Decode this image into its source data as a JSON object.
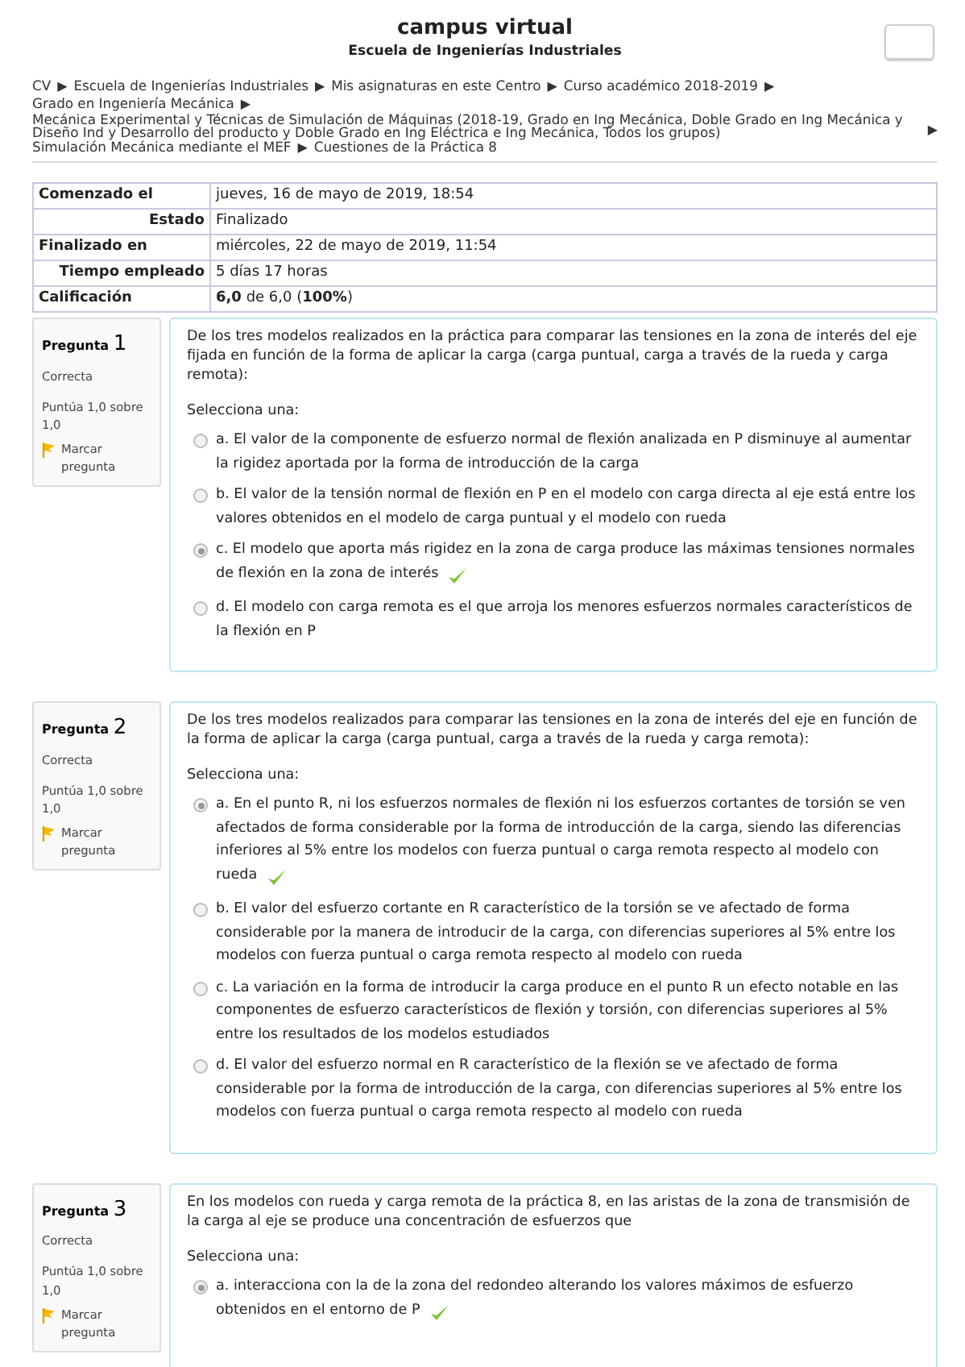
{
  "header": {
    "title": "campus virtual",
    "subtitle": "Escuela de Ingenierías Industriales"
  },
  "breadcrumb": {
    "separator": "▶",
    "lines": [
      [
        "CV",
        "Escuela de Ingenierías Industriales",
        "Mis asignaturas en este Centro",
        "Curso académico 2018-2019"
      ],
      [
        "Grado en Ingeniería Mecánica"
      ],
      [
        "Mecánica Experimental y Técnicas de Simulación de Máquinas (2018-19, Grado en Ing Mecánica, Doble Grado en Ing Mecánica y Diseño Ind y Desarrollo del producto y Doble Grado en Ing Eléctrica e Ing Mecánica, Todos los grupos)"
      ],
      [
        "Simulación Mecánica mediante el MEF",
        "Cuestiones de la Práctica 8"
      ]
    ]
  },
  "summary": [
    {
      "label": "Comenzado el",
      "value": "jueves, 16 de mayo de 2019, 18:54",
      "kind": "plain"
    },
    {
      "label": "Estado",
      "value": "Finalizado",
      "kind": "inset"
    },
    {
      "label": "Finalizado en",
      "value": "miércoles, 22 de mayo de 2019, 11:54",
      "kind": "plain"
    },
    {
      "label": "Tiempo empleado",
      "value": "5 días 17 horas",
      "kind": "inset"
    },
    {
      "label": "Calificación",
      "value": "**6,0** de 6,0 (**100%**)",
      "kind": "plain"
    }
  ],
  "questions": [
    {
      "label": "Pregunta",
      "number": "1",
      "state": "Correcta",
      "score": "Puntúa 1,0 sobre 1,0",
      "flag": "Marcar pregunta",
      "text": "De los tres modelos realizados en la práctica para comparar las tensiones en la zona de interés del eje fijada en función de la forma de aplicar la carga (carga puntual, carga a través de la rueda y carga remota):",
      "prompt": "Selecciona una:",
      "options": [
        {
          "text": "a. El valor de la componente de esfuerzo normal de flexión analizada en P disminuye al aumentar la rigidez aportada por la forma de introducción de la carga",
          "selected": false,
          "correct": false
        },
        {
          "text": "b. El valor de la tensión normal de flexión en P en el modelo con carga directa al eje está entre los valores obtenidos en el modelo de carga puntual y el modelo con rueda",
          "selected": false,
          "correct": false
        },
        {
          "text": "c. El modelo que aporta más rigidez en la zona de carga produce las máximas tensiones normales de flexión en la zona de interés",
          "selected": true,
          "correct": true
        },
        {
          "text": "d. El modelo con carga remota es el que arroja los menores esfuerzos normales característicos de la flexión en P",
          "selected": false,
          "correct": false
        }
      ]
    },
    {
      "label": "Pregunta",
      "number": "2",
      "state": "Correcta",
      "score": "Puntúa 1,0 sobre 1,0",
      "flag": "Marcar pregunta",
      "text": "De los tres modelos realizados para comparar las tensiones en la zona de interés del eje en función de la forma de aplicar la carga (carga puntual, carga a través de la rueda y carga remota):",
      "prompt": "Selecciona una:",
      "options": [
        {
          "text": "a. En el punto R, ni los esfuerzos normales de flexión ni los esfuerzos cortantes de torsión se ven afectados de forma considerable por la forma de introducción de la carga, siendo las diferencias inferiores al 5% entre los modelos con fuerza puntual o carga remota respecto al modelo con rueda",
          "selected": true,
          "correct": true
        },
        {
          "text": "b. El valor del esfuerzo cortante en R característico de la torsión  se ve afectado de forma considerable por la manera de introducir de la carga, con diferencias superiores al 5% entre los modelos con fuerza puntual o carga remota respecto al modelo con rueda",
          "selected": false,
          "correct": false
        },
        {
          "text": "c. La variación en la forma de introducir la carga produce en el punto R un efecto notable en las componentes de esfuerzo característicos de flexión y torsión, con diferencias superiores al 5% entre los resultados de los modelos estudiados",
          "selected": false,
          "correct": false
        },
        {
          "text": "d. El valor del esfuerzo normal en R característico de la flexión se ve afectado de forma considerable por la forma de introducción de la carga, con diferencias superiores al 5% entre los modelos con fuerza puntual o carga remota respecto al modelo con rueda",
          "selected": false,
          "correct": false
        }
      ]
    },
    {
      "label": "Pregunta",
      "number": "3",
      "state": "Correcta",
      "score": "Puntúa 1,0 sobre 1,0",
      "flag": "Marcar pregunta",
      "text": "En los modelos con rueda y carga remota de la práctica 8, en las aristas de la zona de transmisión de la carga al eje  se produce una concentración de esfuerzos que",
      "prompt": "Selecciona una:",
      "options": [
        {
          "text": "a. interacciona con la de la zona del redondeo alterando los valores máximos de esfuerzo obtenidos en el entorno de P",
          "selected": true,
          "correct": true
        }
      ]
    }
  ]
}
